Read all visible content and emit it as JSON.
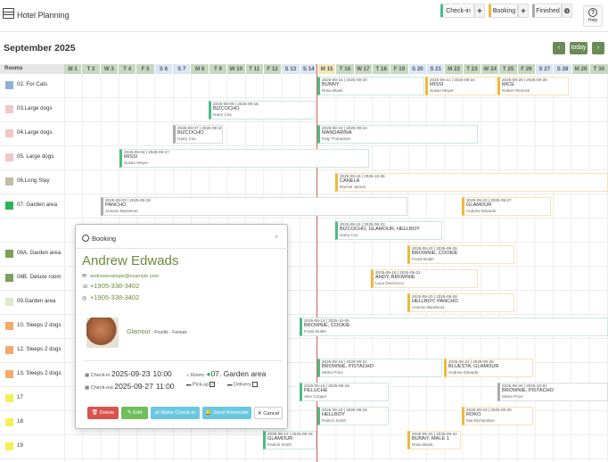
{
  "app": {
    "title": "Hotel Planning"
  },
  "toolbar": {
    "checkin": "Check-in",
    "booking": "Booking",
    "finished": "Finished",
    "plus": "+",
    "help": "Help",
    "colors": {
      "checkin": "#4bbd84",
      "booking": "#efb83e",
      "finished": "#aaaaaa"
    }
  },
  "calendar": {
    "month": "September 2025",
    "today_btn": "today",
    "prev": "‹",
    "next": "›",
    "rooms_head": "Rooms",
    "days": [
      "M 1",
      "T 2",
      "W 3",
      "T 4",
      "F 5",
      "S 6",
      "S 7",
      "M 8",
      "T 9",
      "W 10",
      "T 11",
      "F 12",
      "S 13",
      "S 14",
      "M 15",
      "T 16",
      "W 17",
      "T 18",
      "F 19",
      "S 20",
      "S 21",
      "M 22",
      "T 23",
      "W 24",
      "T 25",
      "F 26",
      "S 27",
      "S 28",
      "M 29",
      "T 30"
    ]
  },
  "rooms": [
    {
      "name": "02. For Cats",
      "color": "#8fb0d8"
    },
    {
      "name": "03.Large dogs",
      "color": "#f0c8c8"
    },
    {
      "name": "04.Large dogs",
      "color": "#f0c8c8"
    },
    {
      "name": "05. Large dogs",
      "color": "#f0c8c8"
    },
    {
      "name": "06.Long Stay",
      "color": "#c2bea4"
    },
    {
      "name": "07. Garden area",
      "color": "#2bb35a"
    },
    {
      "name": "",
      "color": ""
    },
    {
      "name": "08A. Garden area",
      "color": "#7aa05a"
    },
    {
      "name": "08B. Deluxe room",
      "color": "#7aa05a"
    },
    {
      "name": "09.Garden area",
      "color": "#dde8cc"
    },
    {
      "name": "10. Sleeps 2 dogs",
      "color": "#f2a96b"
    },
    {
      "name": "12. Sleeps 2 dogs",
      "color": "#f2a96b"
    },
    {
      "name": "13. Sleeps 2 dogs",
      "color": "#f2a96b"
    },
    {
      "name": "17",
      "color": "#f5f05a"
    },
    {
      "name": "18",
      "color": "#f5f05a"
    },
    {
      "name": "19",
      "color": "#f5f05a"
    }
  ],
  "bookings": [
    {
      "dates": "2025-09-15 | 2025-09-20",
      "name": "BUNNY",
      "guest": "Rosa Blank"
    },
    {
      "dates": "2025-09-21 | 2025-09-24",
      "name": "MISSI",
      "guest": "Susan Meyer"
    },
    {
      "dates": "2025-09-25 | 2025-09-28",
      "name": "MICE",
      "guest": "Robert Rimeral"
    },
    {
      "dates": "2025-09-09 | 2025-09-15",
      "name": "BIZCOCHO",
      "guest": "Harry Cox"
    },
    {
      "dates": "2025-09-07 | 2025-09-10",
      "name": "BIZCOCHO",
      "guest": "Harry Cox"
    },
    {
      "dates": "2025-09-15 | 2025-09-23",
      "name": "MANDARINA",
      "guest": "Paty Thompson"
    },
    {
      "dates": "2025-09-04 | 2025-09-17",
      "name": "MISSI",
      "guest": "Susan Meyer"
    },
    {
      "dates": "2025-09-16 | 2025-10-06",
      "name": "CANELA",
      "guest": "Rachel James"
    },
    {
      "dates": "2025-09-03 | 2025-09-19",
      "name": "PANCHO",
      "guest": "Antonio Banderas"
    },
    {
      "dates": "2025-09-23 | 2025-09-27",
      "name": "GLAMOUR",
      "guest": "Andrew Edwads"
    },
    {
      "dates": "2025-09-16 | 2025-09-22",
      "name": "BIZCOCHO, GLAMOUR, HELLBOY",
      "guest": "Harry Cox"
    },
    {
      "dates": "2025-09-20 | 2025-09-25",
      "name": "BROWNIE, COOKIE",
      "guest": "Frank Butler"
    },
    {
      "dates": "2025-09-18 | 2025-09-21",
      "name": "ANDY, BROWNIE",
      "guest": "Luca DaGrocco"
    },
    {
      "dates": "2025-09-20 | 2025-09-28",
      "name": "HELLBOY, PANCHO",
      "guest": "Antonio Banderas"
    },
    {
      "dates": "2025-09-14 | 2025-10-06",
      "name": "BROWNIE, COOKIE",
      "guest": "Frank Butler"
    },
    {
      "dates": "2025-09-15 | 2025-09-21",
      "name": "BROWNIE, PISTACHO",
      "guest": "Micke Price"
    },
    {
      "dates": "2025-09-22 | 2025-09-26",
      "name": "BLUESTA, GLAMOUR",
      "guest": "Andrew Edwads"
    },
    {
      "dates": "2025-09-15 | 2025-09-18",
      "name": "PELUCHE",
      "guest": "Alex Cooper"
    },
    {
      "dates": "2025-09-26 | 2025-10-01",
      "name": "BROWNIE, PISTACHO",
      "guest": "Micke Price"
    },
    {
      "dates": "2025-09-15 | 2025-09-18",
      "name": "HELLBOY",
      "guest": "Patrick Smith"
    },
    {
      "dates": "2025-09-23 | 2025-09-25",
      "name": "ROKO",
      "guest": "Mia Richardson"
    },
    {
      "dates": "2025-09-12 | 2025-09-15",
      "name": "GLAMOUR",
      "guest": "Patrick Smith"
    },
    {
      "dates": "2025-09-20 | 2025-09-22",
      "name": "BUNNY, MALE 1",
      "guest": "Rosa Blank"
    }
  ],
  "modal": {
    "title": "Booking",
    "guest": "Andrew Edwads",
    "email": "andrewexample@example.com",
    "phone": "+1905-338-3402",
    "whatsapp": "+1905-338-3402",
    "pet_name": "Glamour",
    "pet_info": " - Poodle - Female",
    "checkin_label": "Check-in",
    "checkin_date": "2025-09-23",
    "checkin_time": "10:00",
    "checkout_label": "Check-out",
    "checkout_date": "2025-09-27",
    "checkout_time": "11:00",
    "room_label": "Room:",
    "room": "07. Garden area",
    "pickup_label": "Pick-up",
    "delivery_label": "Delivery",
    "buttons": {
      "delete": "Delete",
      "edit": "Edit",
      "make_checkin": "Make Check-in",
      "send_reminder": "Send Reminder",
      "cancel": "Cancel"
    }
  }
}
